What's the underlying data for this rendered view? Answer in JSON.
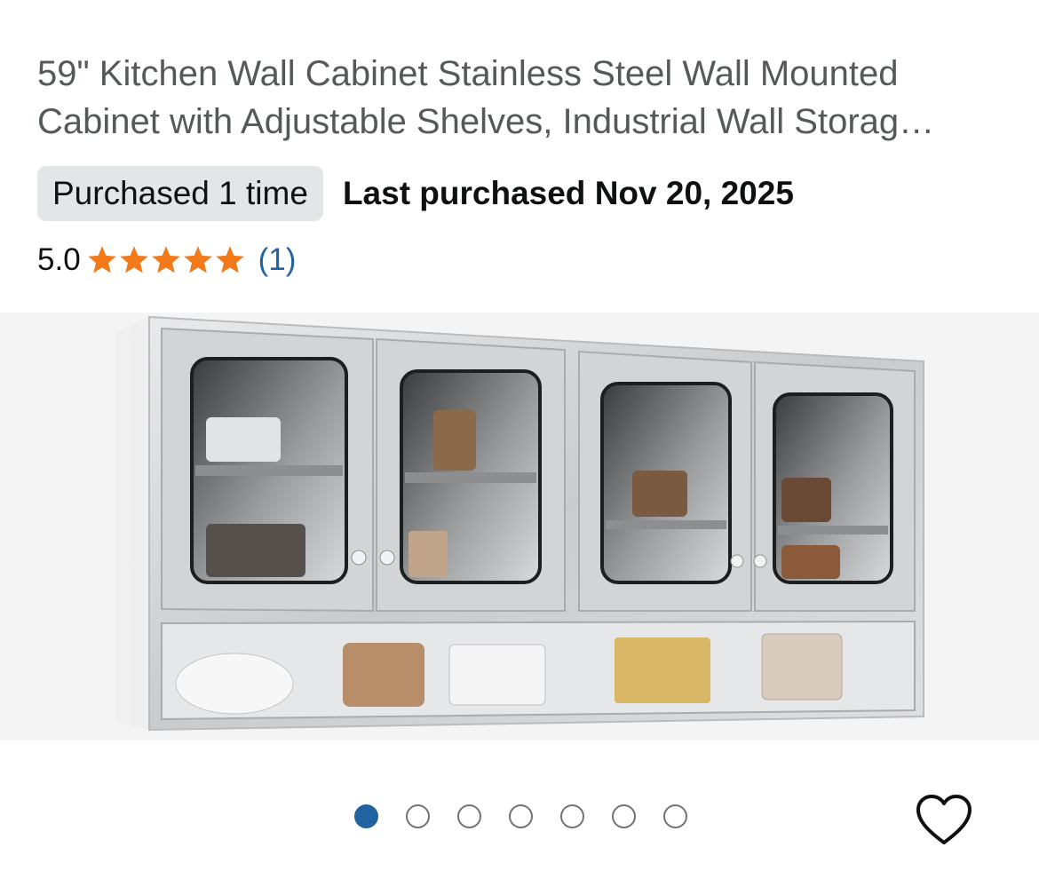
{
  "product": {
    "title": "59\" Kitchen Wall Cabinet Stainless Steel Wall Mounted Cabinet with Adjustable Shelves, Industrial Wall Storag…",
    "purchased_badge": "Purchased 1 time",
    "last_purchased": "Last purchased Nov 20, 2025",
    "rating_value": "5.0",
    "rating_stars": 5,
    "review_count": "(1)",
    "image_icon": "cabinet-product-image",
    "accent_colors": {
      "star": "#f27a1b",
      "link": "#2162a1",
      "badge_bg": "#e3e6e6"
    }
  },
  "carousel": {
    "total_images": 7,
    "active_index": 0,
    "favorite_icon": "heart-outline-icon"
  }
}
